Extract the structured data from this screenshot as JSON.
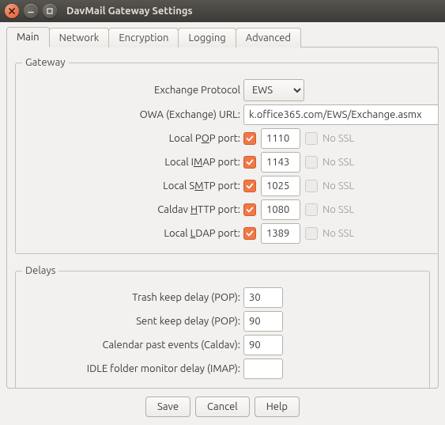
{
  "window": {
    "title": "DavMail Gateway Settings"
  },
  "tabs": {
    "main": "Main",
    "network": "Network",
    "encryption": "Encryption",
    "logging": "Logging",
    "advanced": "Advanced"
  },
  "sections": {
    "gateway": "Gateway",
    "delays": "Delays"
  },
  "gateway": {
    "protocol_label": "Exchange Protocol",
    "protocol_value": "EWS",
    "url_label": "OWA (Exchange) URL:",
    "url_value": "k.office365.com/EWS/Exchange.asmx",
    "nossl_label": "No SSL",
    "ports": {
      "pop": {
        "label": "Local POP port:",
        "value": "1110",
        "enabled": true,
        "nossl": false
      },
      "imap": {
        "label": "Local IMAP port:",
        "value": "1143",
        "enabled": true,
        "nossl": false
      },
      "smtp": {
        "label": "Local SMTP port:",
        "value": "1025",
        "enabled": true,
        "nossl": false
      },
      "caldav": {
        "label": "Caldav HTTP port:",
        "value": "1080",
        "enabled": true,
        "nossl": false
      },
      "ldap": {
        "label": "Local LDAP port:",
        "value": "1389",
        "enabled": true,
        "nossl": false
      }
    }
  },
  "delays": {
    "trash": {
      "label": "Trash keep delay (POP):",
      "value": "30"
    },
    "sent": {
      "label": "Sent keep delay (POP):",
      "value": "90"
    },
    "calendar": {
      "label": "Calendar past events (Caldav):",
      "value": "90"
    },
    "idle": {
      "label": "IDLE folder monitor delay (IMAP):",
      "value": ""
    }
  },
  "buttons": {
    "save": "Save",
    "cancel": "Cancel",
    "help": "Help"
  }
}
